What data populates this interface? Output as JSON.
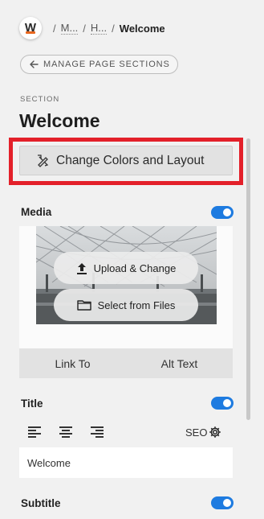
{
  "breadcrumb": {
    "items": [
      "M...",
      "H..."
    ],
    "separator": "/",
    "current": "Welcome"
  },
  "logo": {
    "letter": "W",
    "accent_color": "#e8661e"
  },
  "manage_button": {
    "label": "MANAGE PAGE SECTIONS",
    "icon": "arrow-left-icon"
  },
  "section": {
    "label": "SECTION",
    "title": "Welcome"
  },
  "change_colors_button": {
    "label": "Change Colors and Layout",
    "icon": "paint-tools-icon"
  },
  "highlight_color": "#e3202a",
  "toggle_color": "#1e7be0",
  "media": {
    "label": "Media",
    "enabled": true,
    "upload_label": "Upload & Change",
    "select_label": "Select from Files",
    "link_to_label": "Link To",
    "alt_text_label": "Alt Text"
  },
  "title_field": {
    "label": "Title",
    "enabled": true,
    "seo_label": "SEO",
    "value": "Welcome",
    "alignments": [
      "align-left-icon",
      "align-center-icon",
      "align-right-icon"
    ]
  },
  "subtitle_field": {
    "label": "Subtitle",
    "enabled": true
  }
}
